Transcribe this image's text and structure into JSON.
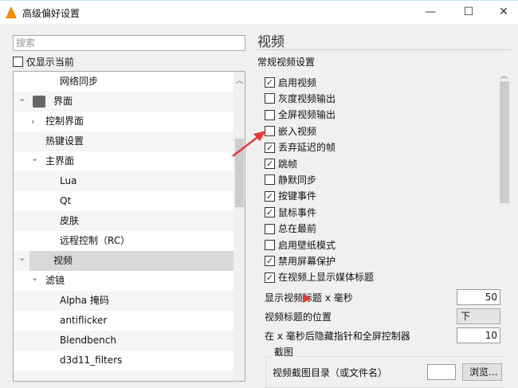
{
  "window": {
    "title": "高级偏好设置",
    "minimize": "—",
    "maximize": "☐",
    "close": "✕"
  },
  "search": {
    "placeholder": "搜索"
  },
  "show_current_only": {
    "label": "仅显示当前",
    "checked": false
  },
  "tree": [
    {
      "label": "网络同步",
      "level": 2,
      "expander": ""
    },
    {
      "label": "界面",
      "level": 0,
      "expander": "open",
      "icon": "paint-roller-icon"
    },
    {
      "label": "控制界面",
      "level": 1,
      "expander": "closed"
    },
    {
      "label": "热键设置",
      "level": 1,
      "expander": ""
    },
    {
      "label": "主界面",
      "level": 1,
      "expander": "open"
    },
    {
      "label": "Lua",
      "level": 2,
      "expander": ""
    },
    {
      "label": "Qt",
      "level": 2,
      "expander": ""
    },
    {
      "label": "皮肤",
      "level": 2,
      "expander": ""
    },
    {
      "label": "远程控制（RC）",
      "level": 2,
      "expander": ""
    },
    {
      "label": "视频",
      "level": 0,
      "expander": "open",
      "icon": "video-settings-icon",
      "selected": true
    },
    {
      "label": "滤镜",
      "level": 1,
      "expander": "open"
    },
    {
      "label": "Alpha 掩码",
      "level": 2,
      "expander": ""
    },
    {
      "label": "antiflicker",
      "level": 2,
      "expander": ""
    },
    {
      "label": "Blendbench",
      "level": 2,
      "expander": ""
    },
    {
      "label": "d3d11_filters",
      "level": 2,
      "expander": ""
    },
    {
      "label": "",
      "level": 2,
      "expander": ""
    }
  ],
  "panel": {
    "heading": "视频",
    "section": "常规视频设置",
    "options": [
      {
        "label": "启用视频",
        "checked": true
      },
      {
        "label": "灰度视频输出",
        "checked": false
      },
      {
        "label": "全屏视频输出",
        "checked": false
      },
      {
        "label": "嵌入视频",
        "checked": false
      },
      {
        "label": "丢弃延迟的帧",
        "checked": true
      },
      {
        "label": "跳帧",
        "checked": true
      },
      {
        "label": "静默同步",
        "checked": false
      },
      {
        "label": "按键事件",
        "checked": true
      },
      {
        "label": "鼠标事件",
        "checked": true
      },
      {
        "label": "总在最前",
        "checked": false
      },
      {
        "label": "启用壁纸模式",
        "checked": false
      },
      {
        "label": "禁用屏幕保护",
        "checked": true
      },
      {
        "label": "在视频上显示媒体标题",
        "checked": true
      }
    ],
    "title_timeout": {
      "label": "显示视频标题 x 毫秒",
      "value": "50"
    },
    "title_position": {
      "label": "视频标题的位置",
      "value": "下"
    },
    "hide_cursor": {
      "label": "在 x 毫秒后隐藏指针和全屏控制器",
      "value": "10"
    },
    "snapshot": {
      "group": "截图",
      "dir_label": "视频截图目录（或文件名）",
      "dir_value": "",
      "browse": "浏览..."
    }
  },
  "annotation_color": "#e53935"
}
